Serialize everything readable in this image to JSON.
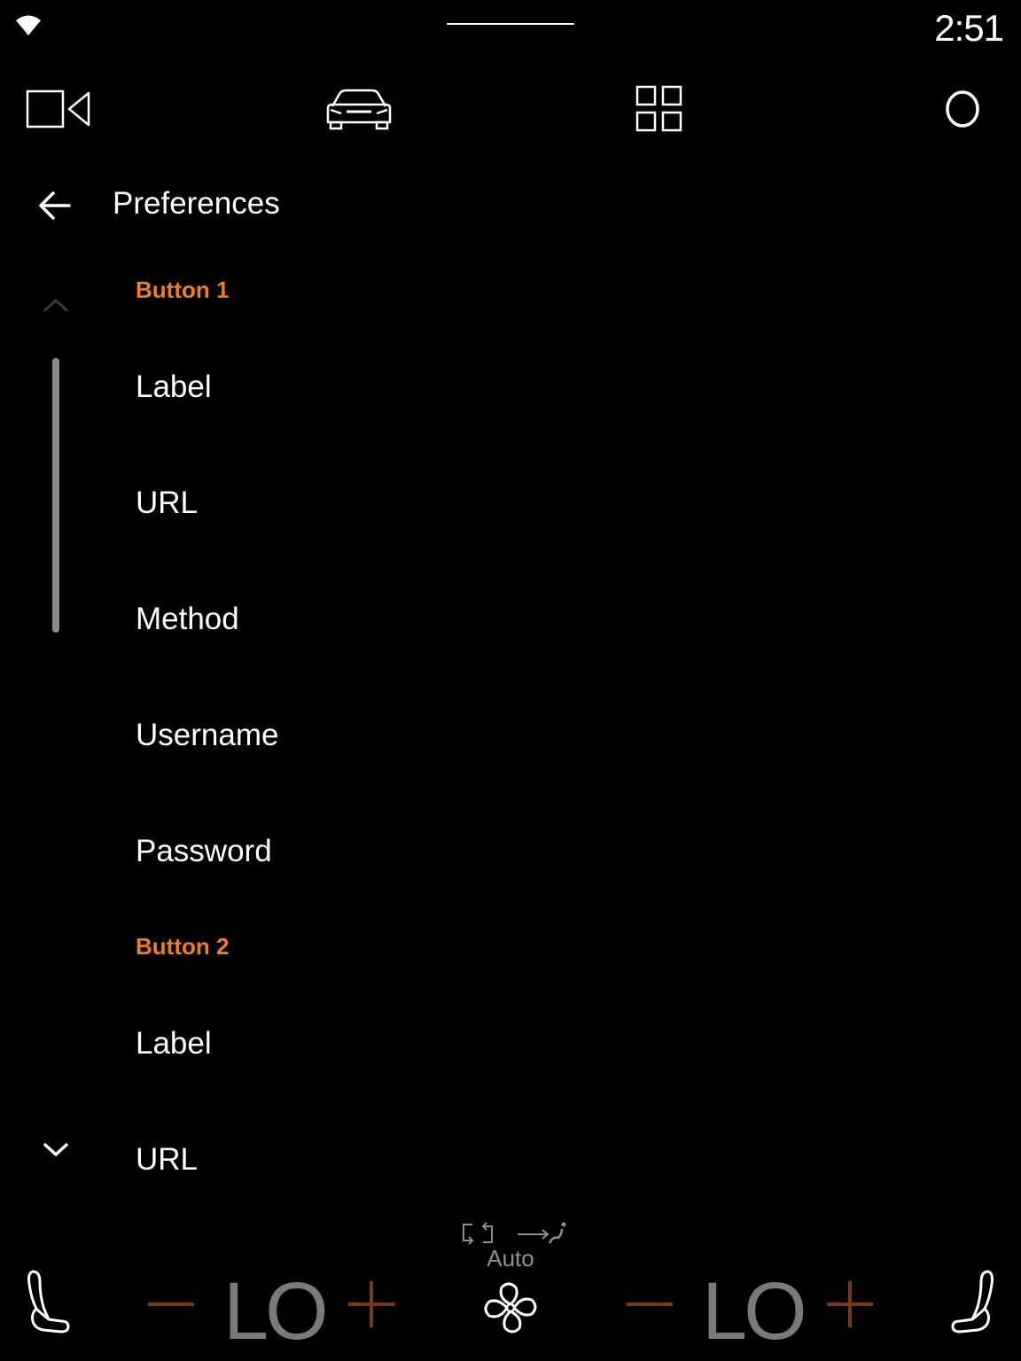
{
  "status_bar": {
    "time": "2:51",
    "wifi_icon": "wifi-icon"
  },
  "top_nav": {
    "items": [
      {
        "id": "camera",
        "icon": "video-camera-icon"
      },
      {
        "id": "car",
        "icon": "car-icon"
      },
      {
        "id": "apps",
        "icon": "app-grid-icon"
      },
      {
        "id": "home",
        "icon": "home-circle-icon"
      }
    ]
  },
  "header": {
    "back_icon": "arrow-left-icon",
    "title": "Preferences"
  },
  "scroll": {
    "up_icon": "chevron-up-icon",
    "down_icon": "chevron-down-icon"
  },
  "sections": [
    {
      "title": "Button 1",
      "items": [
        {
          "label": "Label"
        },
        {
          "label": "URL"
        },
        {
          "label": "Method"
        },
        {
          "label": "Username"
        },
        {
          "label": "Password"
        }
      ]
    },
    {
      "title": "Button 2",
      "items": [
        {
          "label": "Label"
        },
        {
          "label": "URL"
        }
      ]
    }
  ],
  "climate": {
    "left_temp": "LO",
    "right_temp": "LO",
    "fan_mode": "Auto",
    "minus_symbol": "−",
    "plus_symbol": "+",
    "icons": {
      "left_seat": "seat-left-icon",
      "right_seat": "seat-right-icon",
      "recirculation": "recirculation-icon",
      "airflow": "airflow-icon",
      "fan": "fan-icon"
    }
  },
  "colors": {
    "background": "#000000",
    "text": "#ffffff",
    "section_accent": "#ee7e22",
    "climate_adjust": "#7a3c0f",
    "temp_text": "#7a7a7a",
    "scrollbar": "#8a8a8a"
  }
}
